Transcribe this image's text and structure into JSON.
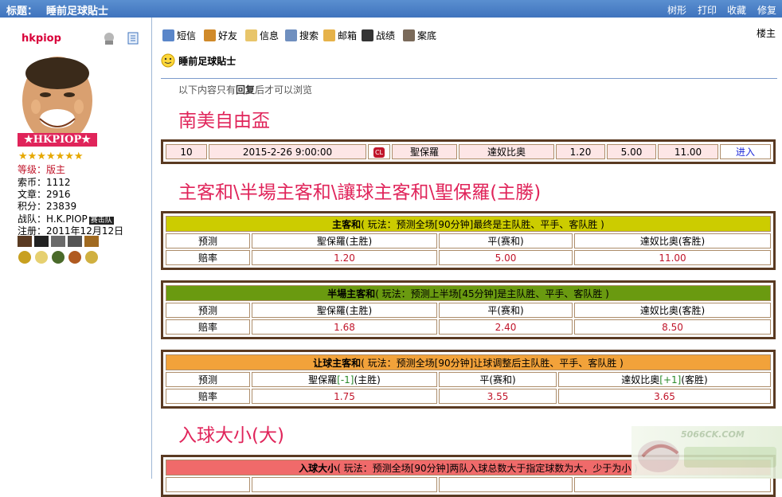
{
  "topbar": {
    "label": "标题：",
    "title": "睡前足球貼士",
    "actions": [
      "树形",
      "打印",
      "收藏",
      "修复"
    ]
  },
  "sidebar": {
    "username": "hkpiop",
    "name_banner": "★HKPIOP★",
    "stars": "★★★★★★★",
    "info": [
      {
        "k": "等级：",
        "v": "版主",
        "red": true
      },
      {
        "k": "索币：",
        "v": "1112"
      },
      {
        "k": "文章：",
        "v": "2916"
      },
      {
        "k": "积分：",
        "v": "23839"
      },
      {
        "k": "战队：",
        "v": "H.K.PIOP",
        "badge": "赛击队"
      },
      {
        "k": "注册：",
        "v": "2011年12月12日"
      }
    ]
  },
  "toolbar": {
    "items": [
      {
        "label": "短信",
        "color": "#5a86c9"
      },
      {
        "label": "好友",
        "color": "#d08a2a"
      },
      {
        "label": "信息",
        "color": "#e8c56a"
      },
      {
        "label": "搜索",
        "color": "#6f8fbf"
      },
      {
        "label": "邮箱",
        "color": "#e6b24a"
      },
      {
        "label": "战绩",
        "color": "#333333"
      },
      {
        "label": "案底",
        "color": "#7a6a5a"
      }
    ],
    "louzhu": "楼主"
  },
  "post": {
    "subject": "睡前足球貼士",
    "note_pre": "以下内容只有",
    "note_bold": "回复",
    "note_post": "后才可以浏览",
    "h_league": "南美自由盃",
    "h_markets": "主客和\\半場主客和\\讓球主客和\\聖保羅(主勝)",
    "h_goals": "入球大小(大)"
  },
  "match": {
    "no": "10",
    "datetime": "2015-2-26 9:00:00",
    "league_icon": "CL",
    "home": "聖保羅",
    "away": "達奴比奧",
    "o1": "1.20",
    "o2": "5.00",
    "o3": "11.00",
    "enter": "进入"
  },
  "tables": [
    {
      "title": "主客和",
      "rule": "( 玩法：预测全场[90分钟]最终是主队胜、平手、客队胜 )",
      "bg": "#cccc00",
      "pred_label": "预测",
      "odds_label": "赔率",
      "cols": [
        "聖保羅(主胜)",
        "平(赛和)",
        "達奴比奧(客胜)"
      ],
      "odds": [
        "1.20",
        "5.00",
        "11.00"
      ]
    },
    {
      "title": "半場主客和",
      "rule": "( 玩法：预测上半场[45分钟]是主队胜、平手、客队胜 )",
      "bg": "#6a9a10",
      "pred_label": "预测",
      "odds_label": "赔率",
      "cols": [
        "聖保羅(主胜)",
        "平(赛和)",
        "達奴比奧(客胜)"
      ],
      "odds": [
        "1.68",
        "2.40",
        "8.50"
      ]
    },
    {
      "title": "让球主客和",
      "rule": "( 玩法：预测全场[90分钟]让球调整后主队胜、平手、客队胜 )",
      "bg": "#f2a23a",
      "pred_label": "预测",
      "odds_label": "赔率",
      "col1_pre": "聖保羅",
      "col1_hc": "[-1]",
      "col1_post": "(主胜)",
      "col2": "平(赛和)",
      "col3_pre": "達奴比奧",
      "col3_hc": "[+1]",
      "col3_post": "(客胜)",
      "odds": [
        "1.75",
        "3.55",
        "3.65"
      ]
    },
    {
      "title": "入球大小",
      "rule": "( 玩法：预测全场[90分钟]两队入球总数大于指定球数为大，少于为小 )",
      "bg": "#f06a6a"
    }
  ],
  "watermark": "5066CK.COM"
}
